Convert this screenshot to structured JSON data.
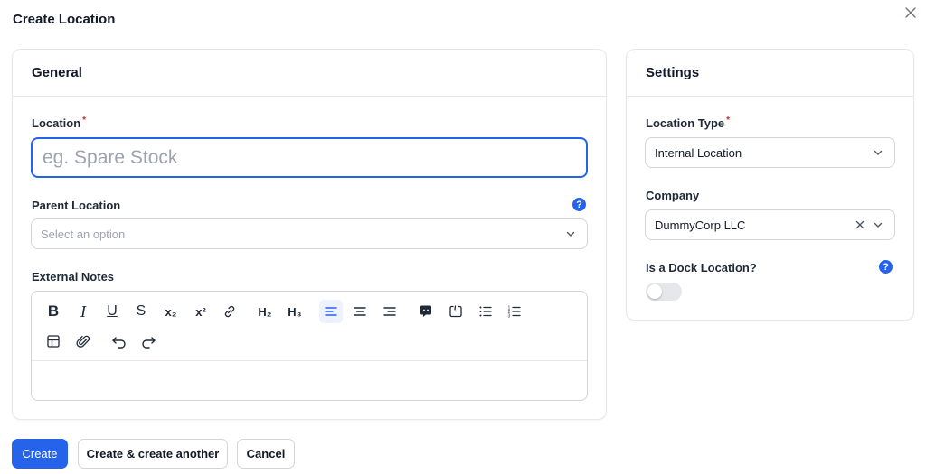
{
  "modal": {
    "title": "Create Location"
  },
  "general": {
    "header": "General",
    "location": {
      "label": "Location",
      "placeholder": "eg. Spare Stock",
      "value": ""
    },
    "parent_location": {
      "label": "Parent Location",
      "placeholder": "Select an option",
      "help": "?"
    },
    "external_notes": {
      "label": "External Notes"
    }
  },
  "settings": {
    "header": "Settings",
    "location_type": {
      "label": "Location Type",
      "value": "Internal Location"
    },
    "company": {
      "label": "Company",
      "value": "DummyCorp LLC"
    },
    "dock": {
      "label": "Is a Dock Location?",
      "help": "?",
      "enabled": false
    }
  },
  "toolbar": {
    "bold": "B",
    "italic": "I",
    "underline": "U",
    "strike": "S",
    "subscript": "x₂",
    "superscript": "x²",
    "h2": "H₂",
    "h3": "H₃"
  },
  "actions": {
    "create": "Create",
    "create_another": "Create & create another",
    "cancel": "Cancel"
  },
  "colors": {
    "primary": "#2563eb",
    "required": "#dc2626"
  }
}
